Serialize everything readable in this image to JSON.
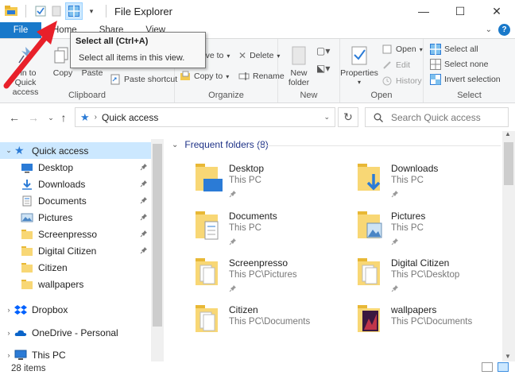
{
  "window": {
    "title": "File Explorer",
    "controls": {
      "minimize": "—",
      "maximize": "☐",
      "close": "✕"
    }
  },
  "ribbon_tabs": [
    {
      "label": "File"
    },
    {
      "label": "Home"
    },
    {
      "label": "Share"
    },
    {
      "label": "View"
    }
  ],
  "ribbon": {
    "clipboard": {
      "label": "Clipboard",
      "pin_label": "Pin to Quick access",
      "copy_label": "Copy",
      "paste_label": "Paste",
      "paste_shortcut_label": "Paste shortcut"
    },
    "organize": {
      "label": "Organize",
      "move_to_label": "Move to",
      "copy_to_label": "Copy to",
      "delete_label": "Delete",
      "rename_label": "Rename"
    },
    "new": {
      "label": "New",
      "new_folder_label": "New folder"
    },
    "open": {
      "label": "Open",
      "properties_label": "Properties",
      "open_label": "Open",
      "edit_label": "Edit",
      "history_label": "History"
    },
    "select": {
      "label": "Select",
      "select_all_label": "Select all",
      "select_none_label": "Select none",
      "invert_selection_label": "Invert selection"
    }
  },
  "tooltip": {
    "title": "Select all (Ctrl+A)",
    "description": "Select all items in this view."
  },
  "address": {
    "path": "Quick access",
    "search_placeholder": "Search Quick access"
  },
  "nav_pane": {
    "items": [
      {
        "label": "Quick access",
        "icon": "star-icon",
        "expand": "expanded",
        "selected": true
      },
      {
        "label": "Desktop",
        "icon": "desktop-folder-icon",
        "pinned": true
      },
      {
        "label": "Downloads",
        "icon": "downloads-folder-icon",
        "pinned": true
      },
      {
        "label": "Documents",
        "icon": "documents-folder-icon",
        "pinned": true
      },
      {
        "label": "Pictures",
        "icon": "pictures-folder-icon",
        "pinned": true
      },
      {
        "label": "Screenpresso",
        "icon": "folder-icon",
        "pinned": true
      },
      {
        "label": "Digital Citizen",
        "icon": "folder-icon",
        "pinned": true
      },
      {
        "label": "Citizen",
        "icon": "folder-icon",
        "pinned": false
      },
      {
        "label": "wallpapers",
        "icon": "folder-icon",
        "pinned": false
      },
      {
        "label": "Dropbox",
        "icon": "dropbox-icon",
        "expand": "collapsed"
      },
      {
        "label": "OneDrive - Personal",
        "icon": "onedrive-icon",
        "expand": "collapsed"
      },
      {
        "label": "This PC",
        "icon": "this-pc-icon",
        "expand": "collapsed"
      }
    ]
  },
  "content": {
    "section_title": "Frequent folders (8)",
    "folders": [
      {
        "name": "Desktop",
        "location": "This PC",
        "icon": "desktop-folder-icon"
      },
      {
        "name": "Downloads",
        "location": "This PC",
        "icon": "downloads-folder-icon"
      },
      {
        "name": "Documents",
        "location": "This PC",
        "icon": "documents-folder-icon"
      },
      {
        "name": "Pictures",
        "location": "This PC",
        "icon": "pictures-folder-icon"
      },
      {
        "name": "Screenpresso",
        "location": "This PC\\Pictures",
        "icon": "folder-icon"
      },
      {
        "name": "Digital Citizen",
        "location": "This PC\\Desktop",
        "icon": "folder-icon"
      },
      {
        "name": "Citizen",
        "location": "This PC\\Documents",
        "icon": "folder-icon"
      },
      {
        "name": "wallpapers",
        "location": "This PC\\Documents",
        "icon": "folder-icon"
      }
    ]
  },
  "status": {
    "item_count": "28 items"
  },
  "colors": {
    "accent": "#1979ca",
    "selection": "#cce8ff",
    "folder_yellow": "#f8d775",
    "folder_dark": "#e8b836",
    "link_blue": "#1e3287",
    "annotation_red": "#e8202a"
  }
}
